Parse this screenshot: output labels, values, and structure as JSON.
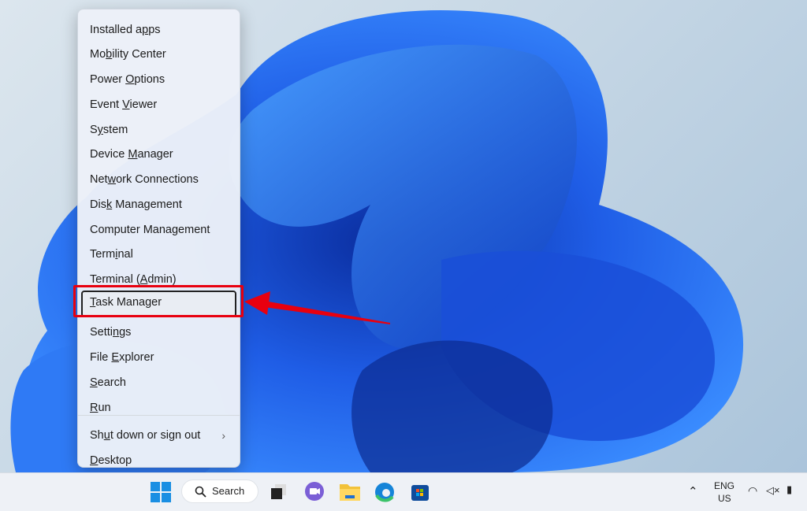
{
  "menu": {
    "items": [
      {
        "pre": "Installed a",
        "key": "p",
        "post": "ps"
      },
      {
        "pre": "Mo",
        "key": "b",
        "post": "ility Center"
      },
      {
        "pre": "Power ",
        "key": "O",
        "post": "ptions"
      },
      {
        "pre": "Event ",
        "key": "V",
        "post": "iewer"
      },
      {
        "pre": "S",
        "key": "y",
        "post": "stem"
      },
      {
        "pre": "Device ",
        "key": "M",
        "post": "anager"
      },
      {
        "pre": "Net",
        "key": "w",
        "post": "ork Connections"
      },
      {
        "pre": "Dis",
        "key": "k",
        "post": " Management"
      },
      {
        "pre": "Computer Mana",
        "key": "g",
        "post": "ement"
      },
      {
        "pre": "Term",
        "key": "i",
        "post": "nal"
      },
      {
        "pre": "Terminal (",
        "key": "A",
        "post": "dmin)"
      },
      {
        "pre": "",
        "key": "T",
        "post": "ask Manager"
      },
      {
        "pre": "Setti",
        "key": "n",
        "post": "gs"
      },
      {
        "pre": "File ",
        "key": "E",
        "post": "xplorer"
      },
      {
        "pre": "",
        "key": "S",
        "post": "earch"
      },
      {
        "pre": "",
        "key": "R",
        "post": "un"
      },
      {
        "pre": "Sh",
        "key": "u",
        "post": "t down or sign out"
      },
      {
        "pre": "",
        "key": "D",
        "post": "esktop"
      }
    ],
    "selected": "Task Manager",
    "highlight_color": "#e8000f"
  },
  "taskbar": {
    "search_label": "Search",
    "lang_top": "ENG",
    "lang_bottom": "US"
  }
}
